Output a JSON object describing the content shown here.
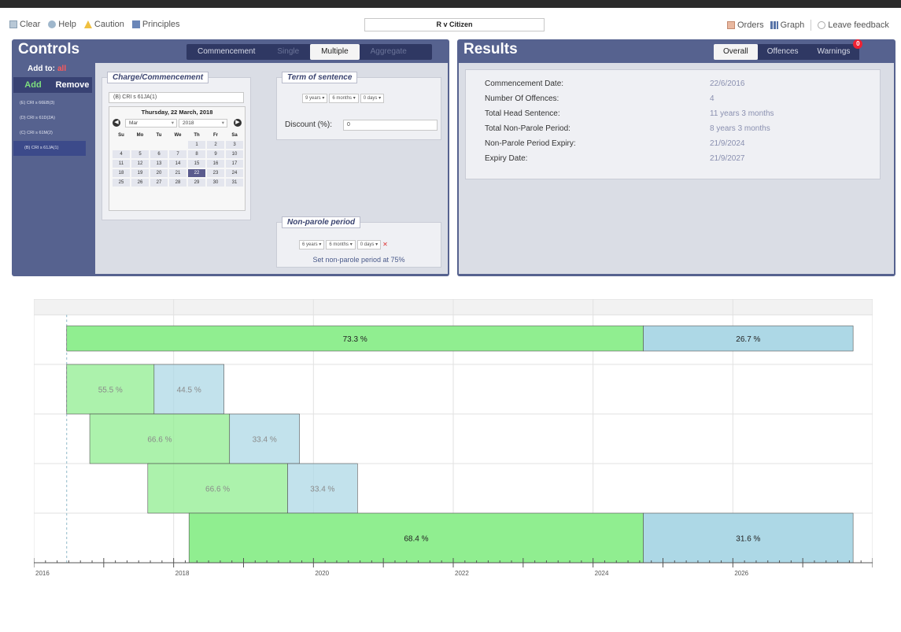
{
  "toolbar": {
    "clear": "Clear",
    "help": "Help",
    "caution": "Caution",
    "principles": "Principles",
    "case_title": "R v Citizen",
    "orders": "Orders",
    "graph": "Graph",
    "feedback": "Leave feedback"
  },
  "controls": {
    "title": "Controls",
    "tabs": [
      "Commencement",
      "Single",
      "Multiple",
      "Aggregate"
    ],
    "add_to_label": "Add to:",
    "add_to_value": "all",
    "add_label": "Add",
    "remove_label": "Remove",
    "offences": [
      "(E) CRI s 66EB(3)",
      "(D) CRI s 61D(2A)",
      "(C) CRI s 61M(2)",
      "(B) CRI s 61JA(1)"
    ],
    "charge_legend": "Charge/Commencement",
    "charge_value": "(B) CRI s 61JA(1)",
    "calendar": {
      "title": "Thursday, 22 March, 2018",
      "month": "Mar",
      "year": "2018",
      "day_headers": [
        "Su",
        "Mo",
        "Tu",
        "We",
        "Th",
        "Fr",
        "Sa"
      ],
      "days": [
        "",
        "",
        "",
        "",
        "1",
        "2",
        "3",
        "4",
        "5",
        "6",
        "7",
        "8",
        "9",
        "10",
        "11",
        "12",
        "13",
        "14",
        "15",
        "16",
        "17",
        "18",
        "19",
        "20",
        "21",
        "22",
        "23",
        "24",
        "25",
        "26",
        "27",
        "28",
        "29",
        "30",
        "31"
      ],
      "selected": "22"
    },
    "term_legend": "Term of sentence",
    "term": {
      "years": "9 years",
      "months": "6 months",
      "days": "0 days"
    },
    "discount_label": "Discount (%):",
    "discount_value": "0",
    "npp_legend": "Non-parole period",
    "npp": {
      "years": "6 years",
      "months": "6 months",
      "days": "0 days"
    },
    "npp_link": "Set non-parole period at 75%"
  },
  "results": {
    "title": "Results",
    "tabs": [
      "Overall",
      "Offences",
      "Warnings"
    ],
    "warnings_count": "0",
    "rows": [
      {
        "label": "Commencement Date:",
        "value": "22/6/2016"
      },
      {
        "label": "Number Of Offences:",
        "value": "4"
      },
      {
        "label": "Total Head Sentence:",
        "value": "11 years 3 months"
      },
      {
        "label": "Total Non-Parole Period:",
        "value": "8 years 3 months"
      },
      {
        "label": "Non-Parole Period Expiry:",
        "value": "21/9/2024"
      },
      {
        "label": "Expiry Date:",
        "value": "21/9/2027"
      }
    ]
  },
  "colors": {
    "npp": "#90ee90",
    "head": "#add8e6",
    "panel": "#56628f"
  },
  "chart_data": {
    "type": "bar",
    "orientation": "horizontal-gantt",
    "x_ticks": [
      "2016",
      "2018",
      "2020",
      "2022",
      "2024",
      "2026"
    ],
    "xlim": [
      2016.0,
      2028.0
    ],
    "grid": true,
    "rows": [
      {
        "start": 2016.47,
        "npp_end": 2024.72,
        "end": 2027.72,
        "npp_label": "73.3 %",
        "head_label": "26.7 %",
        "bold": true
      },
      {
        "start": 2016.47,
        "npp_end": 2017.72,
        "end": 2018.72,
        "npp_label": "55.5 %",
        "head_label": "44.5 %",
        "bold": false
      },
      {
        "start": 2016.8,
        "npp_end": 2018.8,
        "end": 2019.8,
        "npp_label": "66.6 %",
        "head_label": "33.4 %",
        "bold": false
      },
      {
        "start": 2017.63,
        "npp_end": 2019.63,
        "end": 2020.63,
        "npp_label": "66.6 %",
        "head_label": "33.4 %",
        "bold": false
      },
      {
        "start": 2018.22,
        "npp_end": 2024.72,
        "end": 2027.72,
        "npp_label": "68.4 %",
        "head_label": "31.6 %",
        "bold": true
      }
    ]
  }
}
